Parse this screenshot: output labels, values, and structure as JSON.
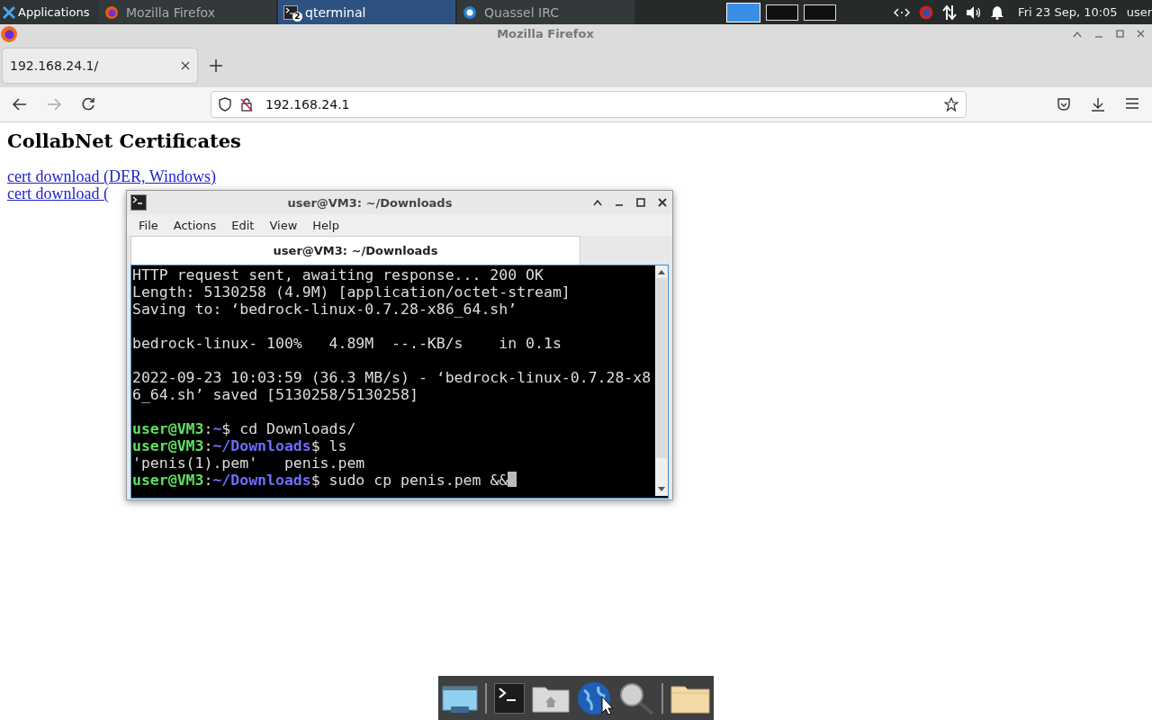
{
  "panel": {
    "menu_label": "Applications",
    "tasks": [
      {
        "label": "Mozilla Firefox",
        "kind": "browser",
        "selected": false
      },
      {
        "label": "qterminal",
        "kind": "terminal",
        "badge": "2",
        "selected": true
      },
      {
        "label": "Quassel IRC",
        "kind": "chat",
        "selected": false
      }
    ],
    "workspaces": [
      {
        "selected": true
      },
      {
        "selected": false
      },
      {
        "selected": false
      }
    ],
    "clock": "Fri 23 Sep, 10:05",
    "user": "user"
  },
  "firefox": {
    "title": "Mozilla Firefox",
    "tabs": [
      {
        "label": "192.168.24.1/"
      }
    ],
    "url": "192.168.24.1",
    "page": {
      "heading": "CollabNet Certificates",
      "links": [
        "cert download (DER, Windows)",
        "cert download ("
      ]
    }
  },
  "terminal": {
    "title": "user@VM3: ~/Downloads",
    "menu": [
      "File",
      "Actions",
      "Edit",
      "View",
      "Help"
    ],
    "tab": "user@VM3: ~/Downloads",
    "blocks": [
      [
        [
          {
            "kind": "text",
            "text": "HTTP request sent, awaiting response... 200 OK"
          }
        ],
        [
          {
            "kind": "text",
            "text": "Length: 5130258 (4.9M) [application/octet-stream]"
          }
        ],
        [
          {
            "kind": "text",
            "text": "Saving to: ‘bedrock-linux-0.7.28-x86_64.sh’"
          }
        ]
      ],
      [
        [
          {
            "kind": "text",
            "text": "bedrock-linux- 100%   4.89M  --.-KB/s    in 0.1s"
          }
        ]
      ],
      [
        [
          {
            "kind": "text",
            "text": "2022-09-23 10:03:59 (36.3 MB/s) - ‘bedrock-linux-0.7.28-x8"
          }
        ],
        [
          {
            "kind": "text",
            "text": "6_64.sh’ saved [5130258/5130258]"
          }
        ]
      ],
      [
        [
          {
            "kind": "user",
            "text": "user@VM3"
          },
          {
            "kind": "text",
            "text": ":"
          },
          {
            "kind": "path",
            "text": "~"
          },
          {
            "kind": "text",
            "text": "$ cd Downloads/"
          }
        ],
        [
          {
            "kind": "user",
            "text": "user@VM3"
          },
          {
            "kind": "text",
            "text": ":"
          },
          {
            "kind": "path",
            "text": "~/Downloads"
          },
          {
            "kind": "text",
            "text": "$ ls"
          }
        ],
        [
          {
            "kind": "text",
            "text": "'penis(1).pem'   penis.pem"
          }
        ],
        [
          {
            "kind": "user",
            "text": "user@VM3"
          },
          {
            "kind": "text",
            "text": ":"
          },
          {
            "kind": "path",
            "text": "~/Downloads"
          },
          {
            "kind": "text",
            "text": "$ sudo cp penis.pem &&"
          }
        ]
      ]
    ]
  },
  "dock": {
    "items": [
      {
        "kind": "window"
      },
      {
        "kind": "terminal"
      },
      {
        "kind": "home"
      },
      {
        "kind": "globe"
      },
      {
        "kind": "search"
      },
      {
        "kind": "folder"
      }
    ]
  }
}
